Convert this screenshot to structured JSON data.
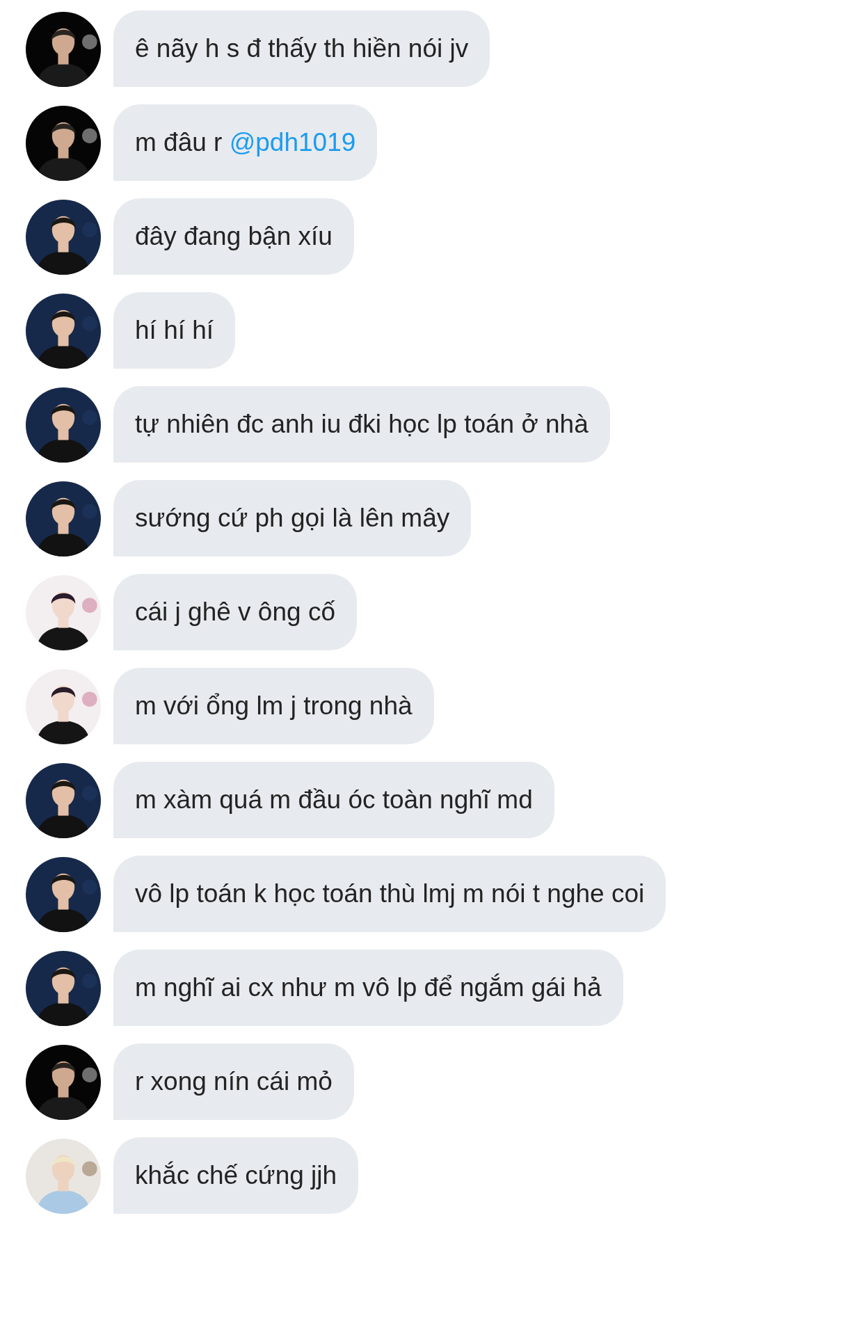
{
  "messages": [
    {
      "text": "ê nãy h s đ thấy th hiền nói jv"
    },
    {
      "text": "m đâu r ",
      "mention": "@pdh1019"
    },
    {
      "text": "đây đang bận xíu"
    },
    {
      "text": "hí hí hí"
    },
    {
      "text": "tự nhiên đc anh iu đki học lp toán ở nhà"
    },
    {
      "text": "sướng cứ ph gọi là lên mây"
    },
    {
      "text": "cái j ghê v ông cố"
    },
    {
      "text": "m với ổng lm j trong nhà"
    },
    {
      "text": "m xàm quá m đầu óc toàn nghĩ md"
    },
    {
      "text": "vô lp toán k học toán thù lmj m nói t nghe coi"
    },
    {
      "text": "m nghĩ ai cx như m vô lp để ngắm gái hả"
    },
    {
      "text": "r xong nín cái mỏ"
    },
    {
      "text": "khắc chế cứng jjh"
    }
  ]
}
